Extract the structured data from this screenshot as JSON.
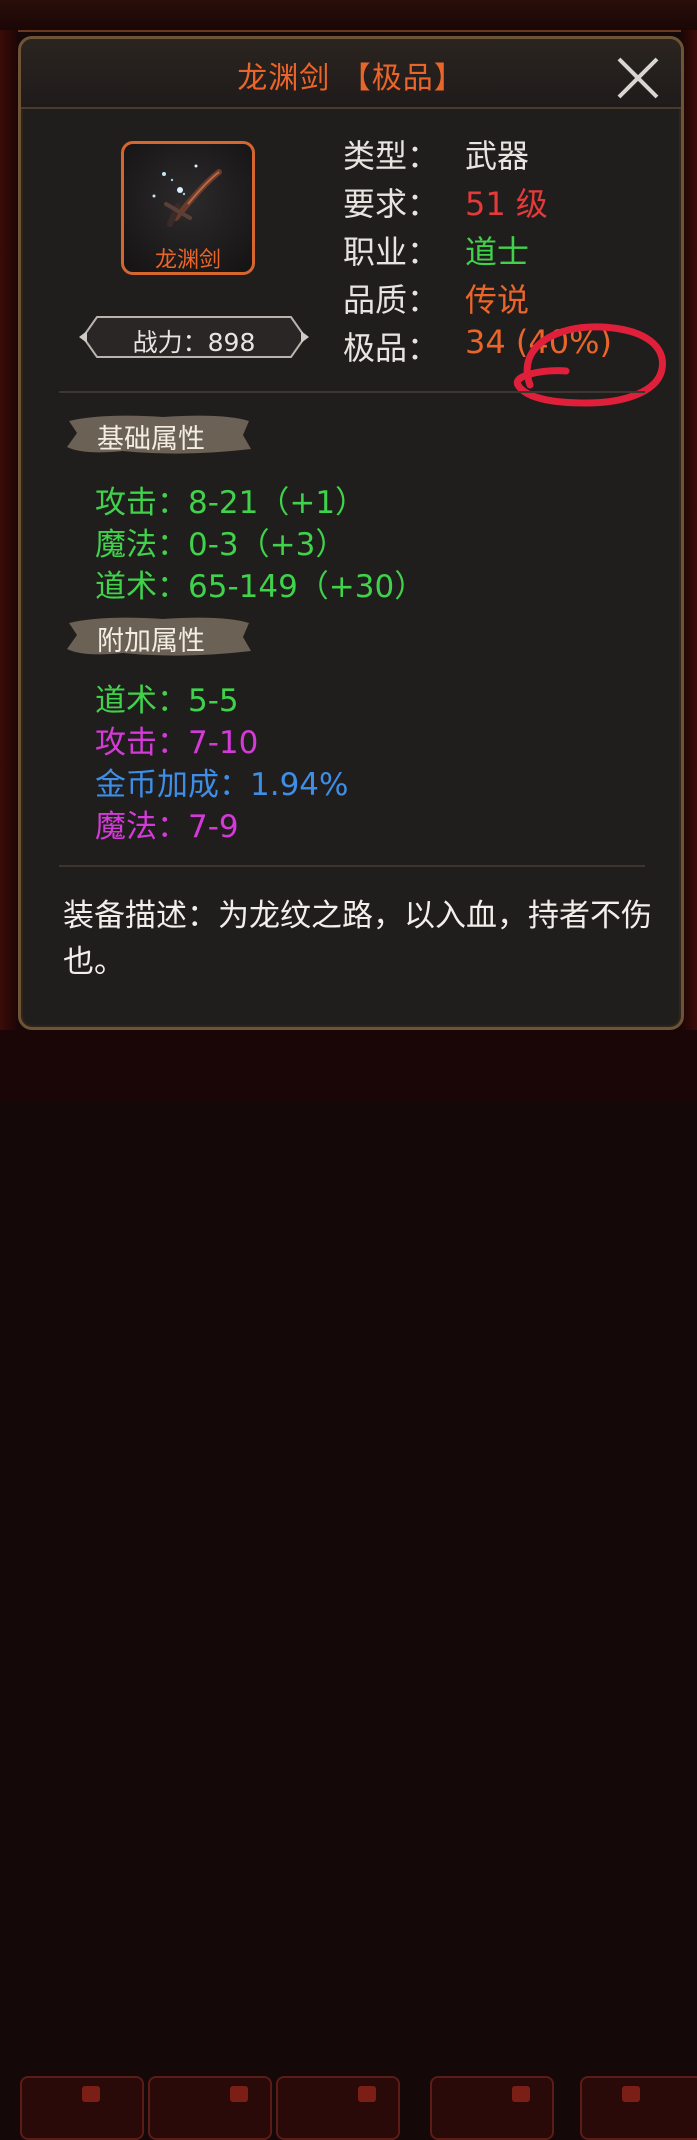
{
  "colors": {
    "orange": "#e9652a",
    "red": "#e43a3a",
    "green": "#3fd24a",
    "purple": "#d33ad8",
    "blue": "#3e8de6",
    "white": "#e8e4e0",
    "annotation_red": "#e0203a"
  },
  "window": {
    "title": "龙渊剑 【极品】",
    "close_icon": "close-x-icon"
  },
  "item": {
    "name": "龙渊剑",
    "icon": "sword-icon",
    "power": "战力：898"
  },
  "info": {
    "type_label": "类型：",
    "type_value": "武器",
    "require_label": "要求：",
    "require_value": "51 级",
    "class_label": "职业：",
    "class_value": "道士",
    "quality_label": "品质：",
    "quality_value": "传说",
    "superior_label": "极品：",
    "superior_value": "34 (40%)"
  },
  "base_attrs": {
    "header": "基础属性",
    "items": [
      "攻击：8-21（+1）",
      "魔法：0-3（+3）",
      "道术：65-149（+30）"
    ]
  },
  "extra_attrs": {
    "header": "附加属性",
    "items": [
      "道术：5-5",
      "攻击：7-10",
      "金币加成：1.94%",
      "魔法：7-9"
    ]
  },
  "description": "装备描述：为龙纹之路，以入血，持者不伤也。"
}
